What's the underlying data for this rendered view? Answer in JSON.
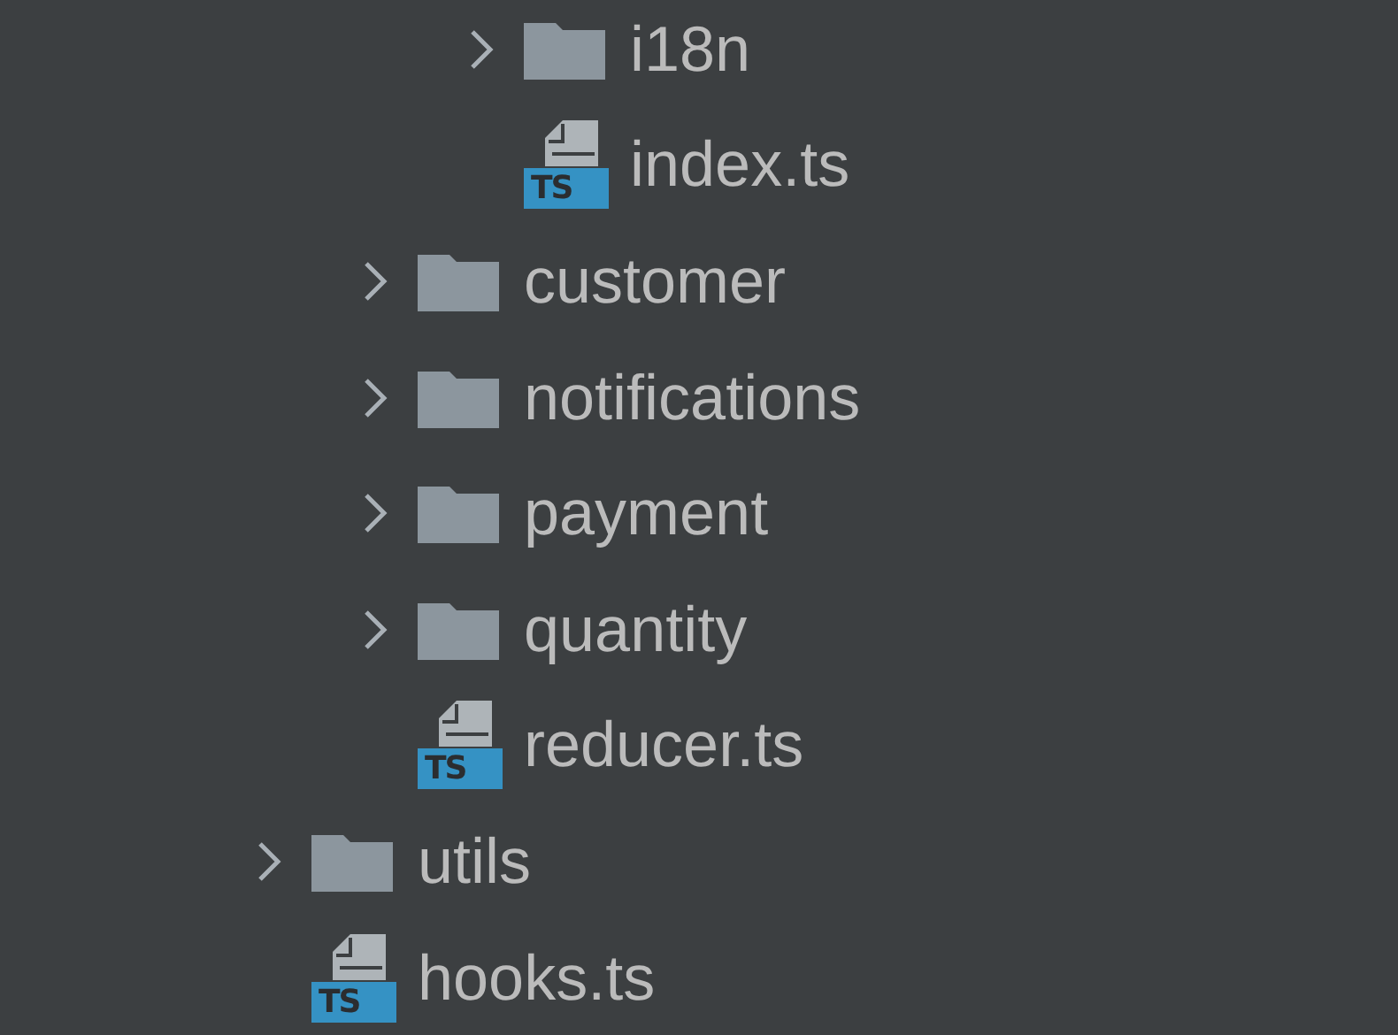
{
  "tree": {
    "items": [
      {
        "children": [
          {
            "children": [
              {
                "kind": "folder",
                "label": "i18n",
                "expanded": false
              },
              {
                "kind": "ts-file",
                "label": "index.ts",
                "badge": "TS"
              }
            ]
          },
          {
            "kind": "folder",
            "label": "customer",
            "expanded": false
          },
          {
            "kind": "folder",
            "label": "notifications",
            "expanded": false
          },
          {
            "kind": "folder",
            "label": "payment",
            "expanded": false
          },
          {
            "kind": "folder",
            "label": "quantity",
            "expanded": false
          },
          {
            "kind": "ts-file",
            "label": "reducer.ts",
            "badge": "TS"
          }
        ]
      },
      {
        "kind": "folder",
        "label": "utils",
        "expanded": false
      },
      {
        "kind": "ts-file",
        "label": "hooks.ts",
        "badge": "TS"
      }
    ]
  }
}
